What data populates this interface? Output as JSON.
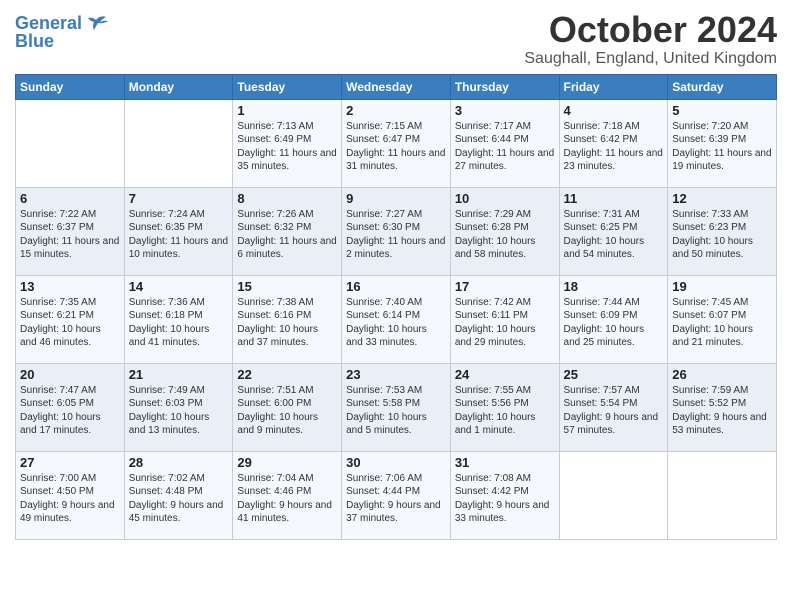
{
  "header": {
    "logo_line1": "General",
    "logo_line2": "Blue",
    "month": "October 2024",
    "location": "Saughall, England, United Kingdom"
  },
  "days_of_week": [
    "Sunday",
    "Monday",
    "Tuesday",
    "Wednesday",
    "Thursday",
    "Friday",
    "Saturday"
  ],
  "weeks": [
    [
      {
        "day": "",
        "info": ""
      },
      {
        "day": "",
        "info": ""
      },
      {
        "day": "1",
        "info": "Sunrise: 7:13 AM\nSunset: 6:49 PM\nDaylight: 11 hours and 35 minutes."
      },
      {
        "day": "2",
        "info": "Sunrise: 7:15 AM\nSunset: 6:47 PM\nDaylight: 11 hours and 31 minutes."
      },
      {
        "day": "3",
        "info": "Sunrise: 7:17 AM\nSunset: 6:44 PM\nDaylight: 11 hours and 27 minutes."
      },
      {
        "day": "4",
        "info": "Sunrise: 7:18 AM\nSunset: 6:42 PM\nDaylight: 11 hours and 23 minutes."
      },
      {
        "day": "5",
        "info": "Sunrise: 7:20 AM\nSunset: 6:39 PM\nDaylight: 11 hours and 19 minutes."
      }
    ],
    [
      {
        "day": "6",
        "info": "Sunrise: 7:22 AM\nSunset: 6:37 PM\nDaylight: 11 hours and 15 minutes."
      },
      {
        "day": "7",
        "info": "Sunrise: 7:24 AM\nSunset: 6:35 PM\nDaylight: 11 hours and 10 minutes."
      },
      {
        "day": "8",
        "info": "Sunrise: 7:26 AM\nSunset: 6:32 PM\nDaylight: 11 hours and 6 minutes."
      },
      {
        "day": "9",
        "info": "Sunrise: 7:27 AM\nSunset: 6:30 PM\nDaylight: 11 hours and 2 minutes."
      },
      {
        "day": "10",
        "info": "Sunrise: 7:29 AM\nSunset: 6:28 PM\nDaylight: 10 hours and 58 minutes."
      },
      {
        "day": "11",
        "info": "Sunrise: 7:31 AM\nSunset: 6:25 PM\nDaylight: 10 hours and 54 minutes."
      },
      {
        "day": "12",
        "info": "Sunrise: 7:33 AM\nSunset: 6:23 PM\nDaylight: 10 hours and 50 minutes."
      }
    ],
    [
      {
        "day": "13",
        "info": "Sunrise: 7:35 AM\nSunset: 6:21 PM\nDaylight: 10 hours and 46 minutes."
      },
      {
        "day": "14",
        "info": "Sunrise: 7:36 AM\nSunset: 6:18 PM\nDaylight: 10 hours and 41 minutes."
      },
      {
        "day": "15",
        "info": "Sunrise: 7:38 AM\nSunset: 6:16 PM\nDaylight: 10 hours and 37 minutes."
      },
      {
        "day": "16",
        "info": "Sunrise: 7:40 AM\nSunset: 6:14 PM\nDaylight: 10 hours and 33 minutes."
      },
      {
        "day": "17",
        "info": "Sunrise: 7:42 AM\nSunset: 6:11 PM\nDaylight: 10 hours and 29 minutes."
      },
      {
        "day": "18",
        "info": "Sunrise: 7:44 AM\nSunset: 6:09 PM\nDaylight: 10 hours and 25 minutes."
      },
      {
        "day": "19",
        "info": "Sunrise: 7:45 AM\nSunset: 6:07 PM\nDaylight: 10 hours and 21 minutes."
      }
    ],
    [
      {
        "day": "20",
        "info": "Sunrise: 7:47 AM\nSunset: 6:05 PM\nDaylight: 10 hours and 17 minutes."
      },
      {
        "day": "21",
        "info": "Sunrise: 7:49 AM\nSunset: 6:03 PM\nDaylight: 10 hours and 13 minutes."
      },
      {
        "day": "22",
        "info": "Sunrise: 7:51 AM\nSunset: 6:00 PM\nDaylight: 10 hours and 9 minutes."
      },
      {
        "day": "23",
        "info": "Sunrise: 7:53 AM\nSunset: 5:58 PM\nDaylight: 10 hours and 5 minutes."
      },
      {
        "day": "24",
        "info": "Sunrise: 7:55 AM\nSunset: 5:56 PM\nDaylight: 10 hours and 1 minute."
      },
      {
        "day": "25",
        "info": "Sunrise: 7:57 AM\nSunset: 5:54 PM\nDaylight: 9 hours and 57 minutes."
      },
      {
        "day": "26",
        "info": "Sunrise: 7:59 AM\nSunset: 5:52 PM\nDaylight: 9 hours and 53 minutes."
      }
    ],
    [
      {
        "day": "27",
        "info": "Sunrise: 7:00 AM\nSunset: 4:50 PM\nDaylight: 9 hours and 49 minutes."
      },
      {
        "day": "28",
        "info": "Sunrise: 7:02 AM\nSunset: 4:48 PM\nDaylight: 9 hours and 45 minutes."
      },
      {
        "day": "29",
        "info": "Sunrise: 7:04 AM\nSunset: 4:46 PM\nDaylight: 9 hours and 41 minutes."
      },
      {
        "day": "30",
        "info": "Sunrise: 7:06 AM\nSunset: 4:44 PM\nDaylight: 9 hours and 37 minutes."
      },
      {
        "day": "31",
        "info": "Sunrise: 7:08 AM\nSunset: 4:42 PM\nDaylight: 9 hours and 33 minutes."
      },
      {
        "day": "",
        "info": ""
      },
      {
        "day": "",
        "info": ""
      }
    ]
  ]
}
